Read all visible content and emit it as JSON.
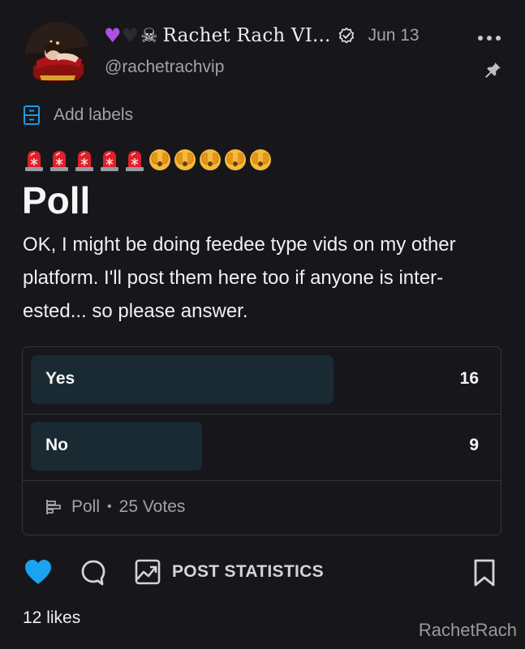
{
  "post": {
    "author": {
      "display_name": "Rachet Rach VI...",
      "emoji_prefix": [
        "purple-heart",
        "black-heart",
        "skull"
      ],
      "handle": "@rachetrachvip",
      "verified": true
    },
    "date": "Jun 13",
    "labels_action": "Add labels",
    "emoji_line": [
      "police-light",
      "police-light",
      "police-light",
      "police-light",
      "police-light",
      "face-peeking",
      "face-peeking",
      "face-peeking",
      "face-peeking",
      "face-peeking"
    ],
    "title": "Poll",
    "body": "OK, I might be doing feedee type vids on my other platform. I'll post them here too if anyone is inter- ested... so please answer."
  },
  "poll": {
    "options": [
      {
        "label": "Yes",
        "votes": "16",
        "fill_fraction": 0.655
      },
      {
        "label": "No",
        "votes": "9",
        "fill_fraction": 0.37
      }
    ],
    "type_label": "Poll",
    "separator": "•",
    "total_votes": "25 Votes"
  },
  "actions": {
    "stats_label": "POST STATISTICS"
  },
  "likes": "12 likes",
  "watermark": "RachetRach",
  "colors": {
    "background": "#17171b",
    "like_heart": "#1aa3f0",
    "poll_fill": "#192a33",
    "labels_icon": "#1e9ae6",
    "muted_text": "#9fa3ab"
  },
  "icons": {
    "more": "more-horizontal-icon",
    "pin": "pin-icon",
    "labels": "labels-icon",
    "poll": "poll-icon",
    "like": "heart-icon",
    "comment": "comment-icon",
    "stats": "stats-chart-icon",
    "bookmark": "bookmark-icon"
  }
}
